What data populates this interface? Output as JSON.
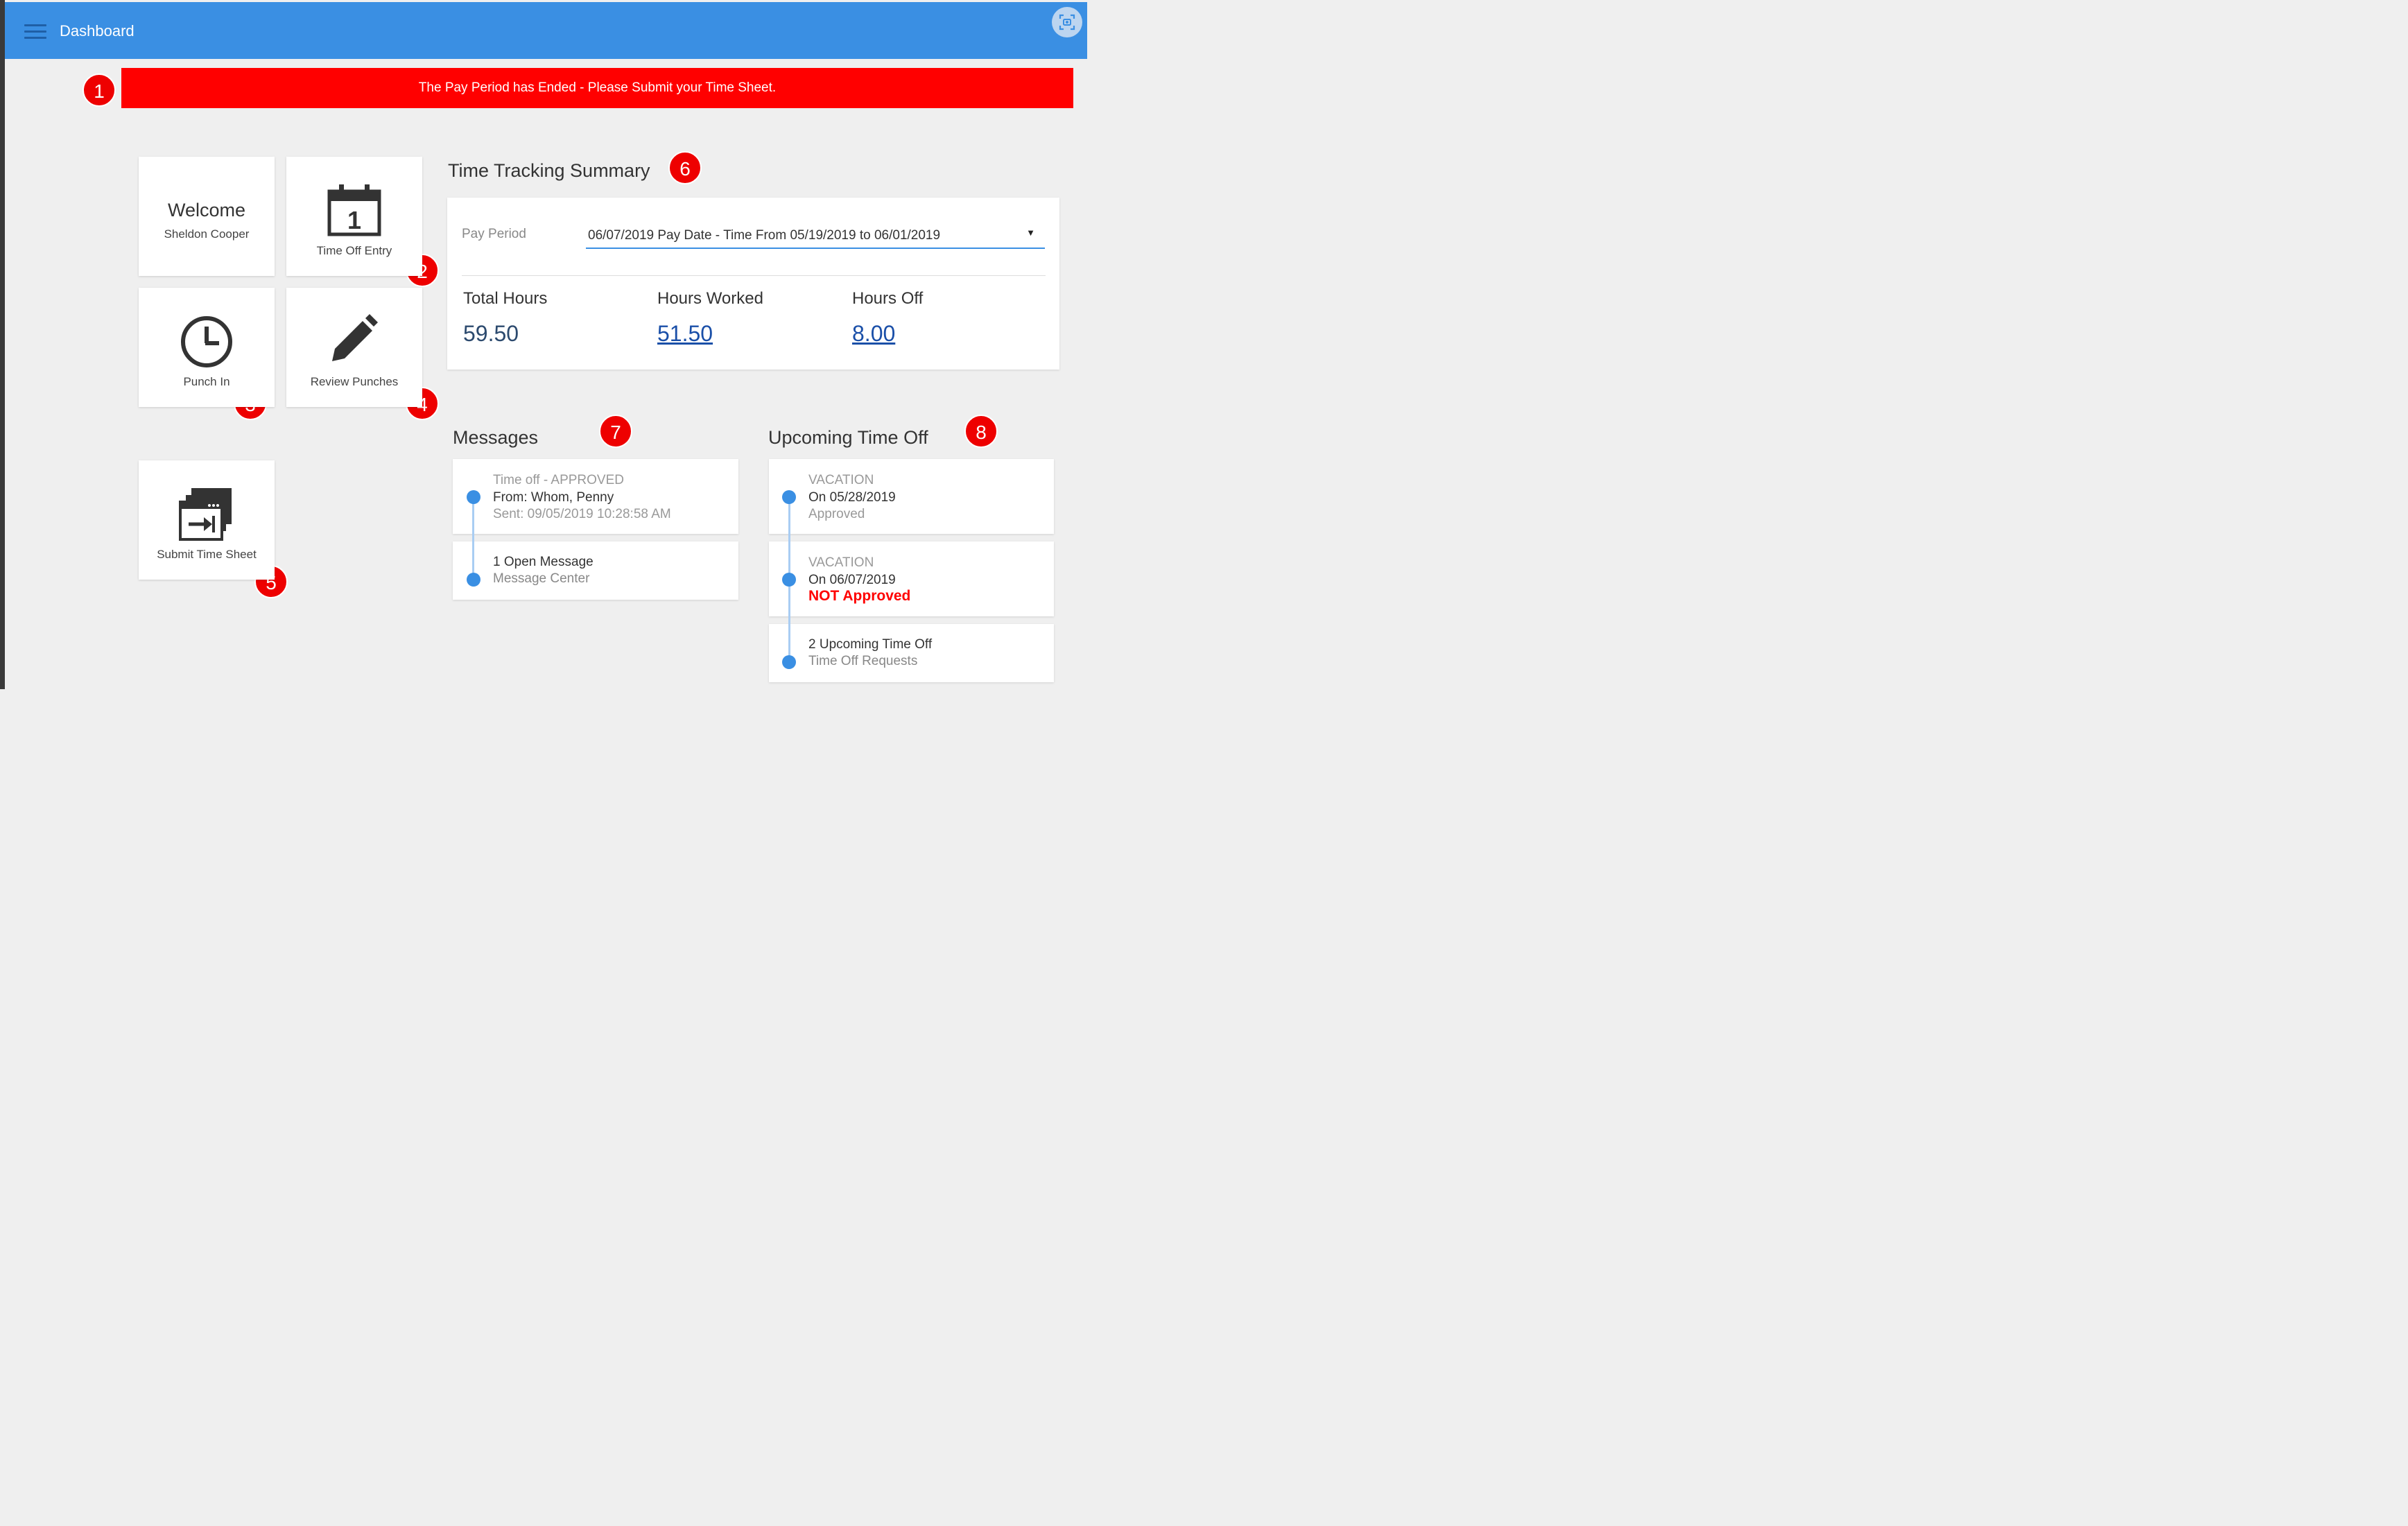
{
  "header": {
    "title": "Dashboard"
  },
  "banner": {
    "text": "The Pay Period has Ended - Please Submit your Time Sheet."
  },
  "badges": [
    "1",
    "2",
    "3",
    "4",
    "5",
    "6",
    "7",
    "8"
  ],
  "tiles": {
    "welcome": {
      "title": "Welcome",
      "name": "Sheldon Cooper"
    },
    "time_off_entry": {
      "label": "Time Off Entry",
      "calendar_day": "1"
    },
    "punch_in": {
      "label": "Punch In"
    },
    "review_punches": {
      "label": "Review Punches"
    },
    "submit_time_sheet": {
      "label": "Submit Time Sheet"
    }
  },
  "summary": {
    "title": "Time Tracking Summary",
    "pay_period_label": "Pay Period",
    "pay_period_value": "06/07/2019 Pay Date - Time From 05/19/2019 to 06/01/2019",
    "total_hours_label": "Total Hours",
    "total_hours_value": "59.50",
    "hours_worked_label": "Hours Worked",
    "hours_worked_value": "51.50",
    "hours_off_label": "Hours Off",
    "hours_off_value": "8.00"
  },
  "messages": {
    "title": "Messages",
    "items": [
      {
        "subject": "Time off - APPROVED",
        "from": "From: Whom, Penny",
        "sent": "Sent: 09/05/2019 10:28:58 AM"
      },
      {
        "title": "1 Open Message",
        "subtitle": "Message Center"
      }
    ]
  },
  "upcoming": {
    "title": "Upcoming Time Off",
    "items": [
      {
        "type": "VACATION",
        "date": "On 05/28/2019",
        "status": "Approved"
      },
      {
        "type": "VACATION",
        "date": "On 06/07/2019",
        "status": "NOT Approved"
      },
      {
        "title": "2 Upcoming Time Off",
        "subtitle": "Time Off Requests"
      }
    ]
  },
  "colors": {
    "accent": "#3a8fe3",
    "banner": "#ff0000",
    "link": "#1a4fa8"
  },
  "icons": {
    "menu": "hamburger-icon",
    "scan": "screenshot-scan-icon",
    "calendar": "calendar-icon",
    "clock": "clock-icon",
    "pencil": "pencil-icon",
    "submit": "submit-windows-icon"
  }
}
